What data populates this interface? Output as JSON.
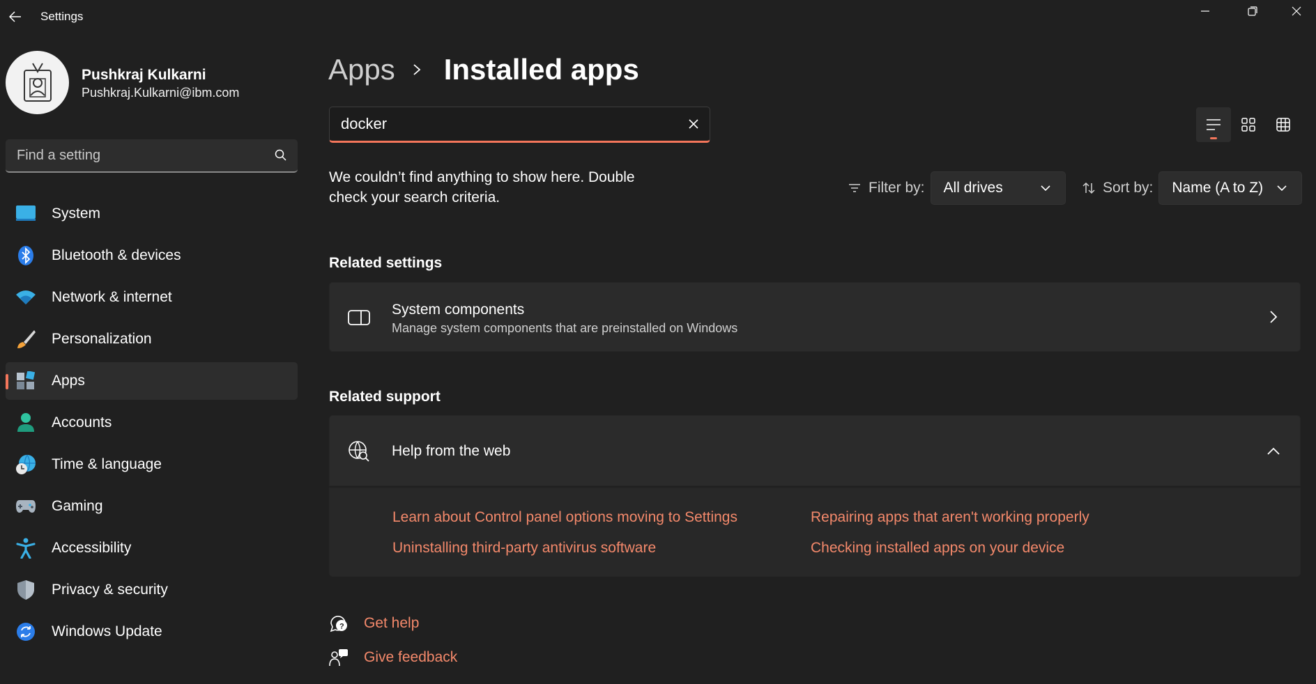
{
  "window": {
    "title": "Settings",
    "back_icon": "back-arrow-icon",
    "controls": [
      "minimize-icon",
      "restore-icon",
      "close-icon"
    ]
  },
  "profile": {
    "name": "Pushkraj Kulkarni",
    "email": "Pushkraj.Kulkarni@ibm.com",
    "avatar_icon": "user-badge-icon"
  },
  "find_setting": {
    "placeholder": "Find a setting",
    "icon": "search-icon"
  },
  "sidebar": {
    "items": [
      {
        "label": "System",
        "icon": "system-monitor-icon",
        "active": false
      },
      {
        "label": "Bluetooth & devices",
        "icon": "bluetooth-icon",
        "active": false
      },
      {
        "label": "Network & internet",
        "icon": "wifi-icon",
        "active": false
      },
      {
        "label": "Personalization",
        "icon": "paintbrush-icon",
        "active": false
      },
      {
        "label": "Apps",
        "icon": "apps-icon",
        "active": true
      },
      {
        "label": "Accounts",
        "icon": "person-icon",
        "active": false
      },
      {
        "label": "Time & language",
        "icon": "globe-clock-icon",
        "active": false
      },
      {
        "label": "Gaming",
        "icon": "gamepad-icon",
        "active": false
      },
      {
        "label": "Accessibility",
        "icon": "accessibility-icon",
        "active": false
      },
      {
        "label": "Privacy & security",
        "icon": "shield-icon",
        "active": false
      },
      {
        "label": "Windows Update",
        "icon": "update-icon",
        "active": false
      }
    ]
  },
  "breadcrumb": {
    "parent": "Apps",
    "current": "Installed apps"
  },
  "search": {
    "value": "docker",
    "clear_icon": "clear-icon"
  },
  "view_modes": [
    "list-view-icon",
    "tile-view-icon",
    "grid-view-icon"
  ],
  "empty_message": "We couldn’t find anything to show here. Double check your search criteria.",
  "filter": {
    "label": "Filter by:",
    "value": "All drives"
  },
  "sort": {
    "label": "Sort by:",
    "value": "Name (A to Z)"
  },
  "related_settings": {
    "title": "Related settings",
    "item": {
      "title": "System components",
      "subtitle": "Manage system components that are preinstalled on Windows"
    }
  },
  "related_support": {
    "title": "Related support",
    "help": {
      "title": "Help from the web",
      "links": [
        "Learn about Control panel options moving to Settings",
        "Repairing apps that aren't working properly",
        "Uninstalling third-party antivirus software",
        "Checking installed apps on your device"
      ]
    }
  },
  "footer": {
    "get_help": "Get help",
    "give_feedback": "Give feedback"
  },
  "colors": {
    "background": "#202020",
    "card": "#2b2b2b",
    "accent": "#f4765b",
    "link": "#f4896b"
  }
}
